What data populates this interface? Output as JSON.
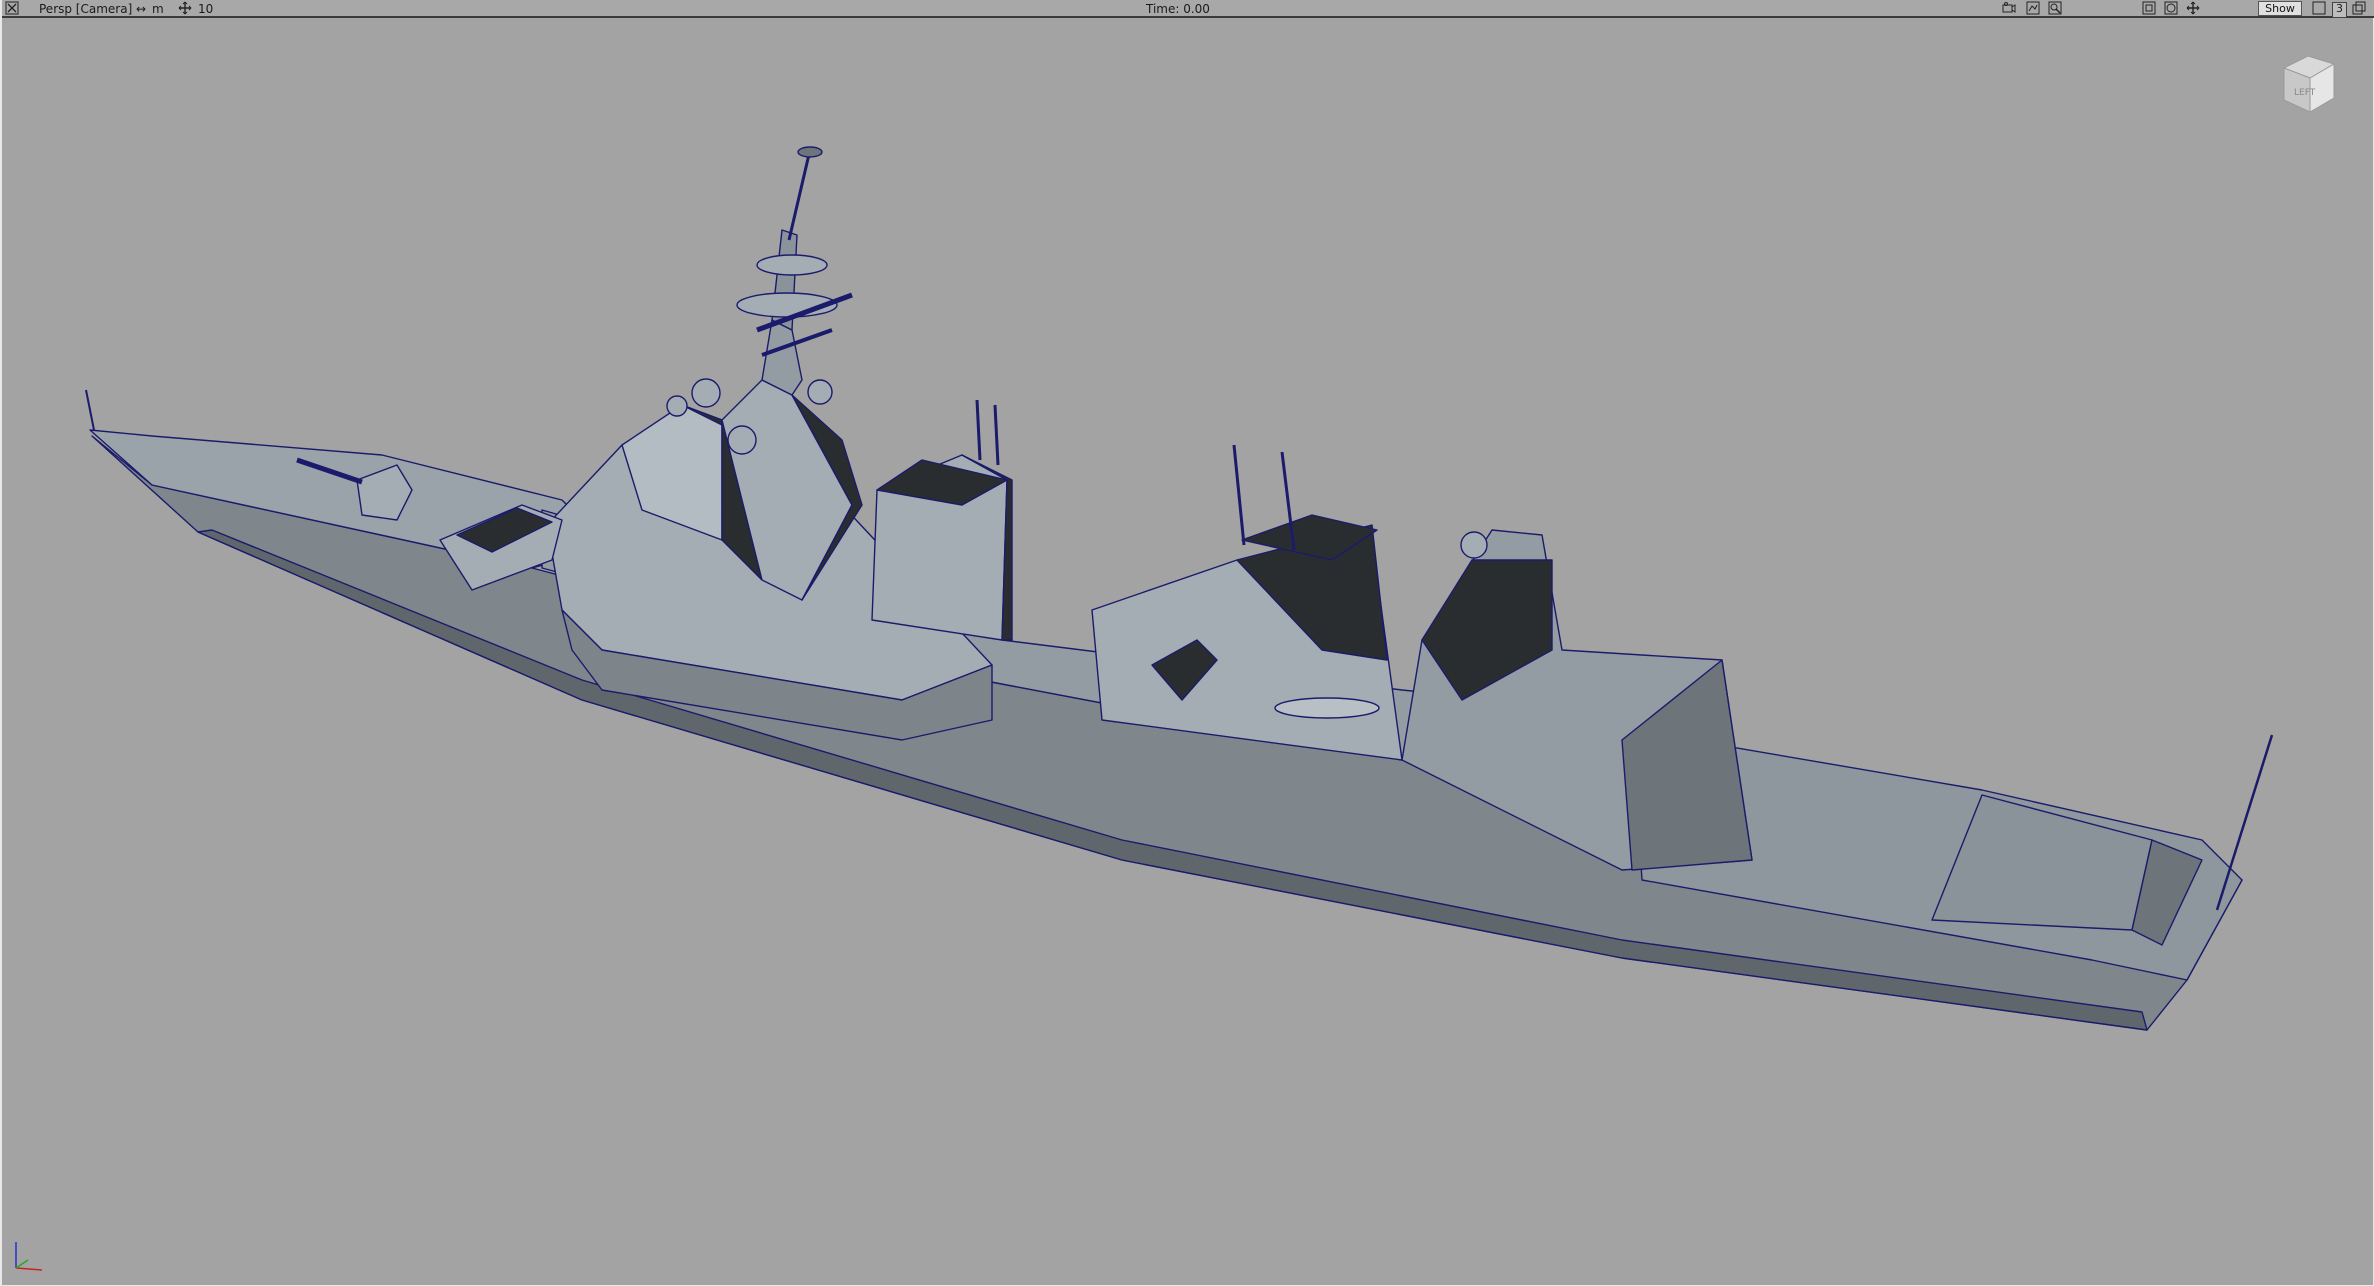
{
  "viewport": {
    "camera_label": "Persp [Camera]",
    "units_label": "m",
    "grid_label": "10",
    "time_label": "Time: 0.00",
    "show_label": "Show",
    "layout_number": "3",
    "view_cube_label": "LEFT"
  },
  "icons": {
    "close": "close-icon",
    "units": "double-arrow-icon",
    "grid": "grid-move-icon",
    "camera": "camera-icon",
    "render": "render-icon",
    "zoom": "magnify-icon",
    "frame": "frame-icon",
    "orbit": "orbit-icon",
    "pan": "pan-icon",
    "single_view": "single-view-icon",
    "maximize": "maximize-icon"
  },
  "colors": {
    "background": "#a3a3a3",
    "hull": "#8c949b",
    "hull_dark": "#5d6469",
    "superstructure": "#a4adb4",
    "shadow": "#2a2d30",
    "wire": "#1b1b6b"
  }
}
